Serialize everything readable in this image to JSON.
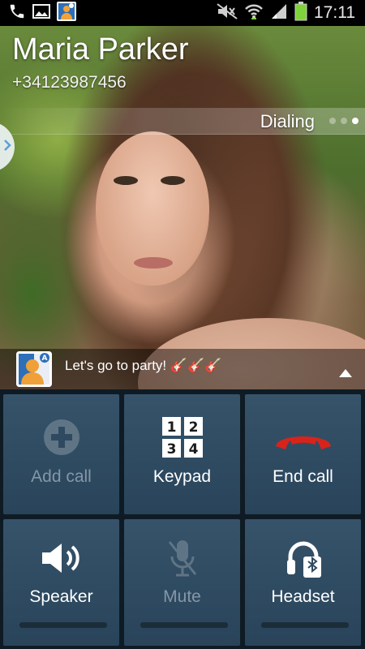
{
  "status_bar": {
    "time": "17:11",
    "icons": [
      "phone-call-icon",
      "gallery-icon",
      "app-notification-icon",
      "mute-icon",
      "wifi-icon",
      "signal-icon",
      "battery-icon"
    ]
  },
  "caller": {
    "name": "Maria Parker",
    "number": "+34123987456",
    "call_state": "Dialing"
  },
  "status_message": {
    "text": "Let's go to party! 🎸🎸🎸"
  },
  "buttons": {
    "add_call": "Add call",
    "keypad": "Keypad",
    "end_call": "End call",
    "speaker": "Speaker",
    "mute": "Mute",
    "headset": "Headset"
  },
  "keypad_digits": [
    "1",
    "2",
    "3",
    "4"
  ],
  "colors": {
    "end_call_red": "#d8231b",
    "button_bg": "#2f4a60",
    "disabled_text": "#8597a6",
    "battery_green": "#7fd23a"
  }
}
